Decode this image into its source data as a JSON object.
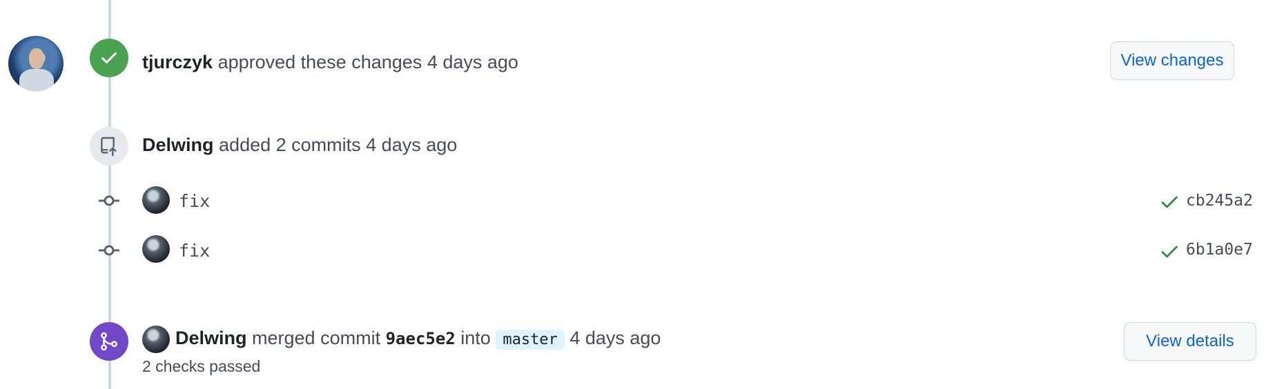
{
  "colors": {
    "approved": "#4aa253",
    "merged": "#7048c8",
    "link": "#0b63d6",
    "check": "#2e8b3a"
  },
  "review": {
    "user": "tjurczyk",
    "action": "approved these changes",
    "time": "4 days ago",
    "button": "View changes",
    "icon": "check-icon"
  },
  "push": {
    "user": "Delwing",
    "action": "added 2 commits",
    "time": "4 days ago",
    "icon": "repo-push-icon"
  },
  "commits": [
    {
      "message": "fix",
      "status_icon": "check-icon",
      "sha": "cb245a2"
    },
    {
      "message": "fix",
      "status_icon": "check-icon",
      "sha": "6b1a0e7"
    }
  ],
  "merge": {
    "user": "Delwing",
    "action": "merged commit",
    "commit": "9aec5e2",
    "into": "into",
    "branch": "master",
    "time": "4 days ago",
    "checks": "2 checks passed",
    "button": "View details",
    "icon": "git-merge-icon"
  }
}
